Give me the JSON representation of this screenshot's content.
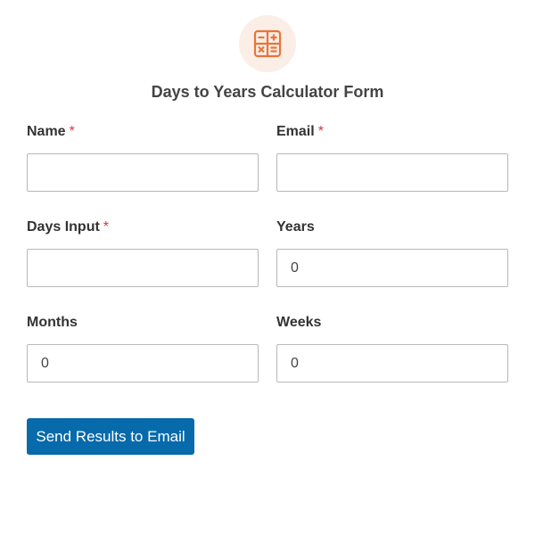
{
  "form": {
    "icon": "calculator-icon",
    "icon_color": "#e8743b",
    "icon_background": "#fbeee6",
    "title": "Days to Years Calculator Form",
    "required_mark": "*",
    "required_color": "#d63637",
    "fields": {
      "name": {
        "label": "Name",
        "value": "",
        "required": true
      },
      "email": {
        "label": "Email",
        "value": "",
        "required": true
      },
      "days_input": {
        "label": "Days Input",
        "value": "",
        "required": true
      },
      "years": {
        "label": "Years",
        "value": "0",
        "required": false
      },
      "months": {
        "label": "Months",
        "value": "0",
        "required": false
      },
      "weeks": {
        "label": "Weeks",
        "value": "0",
        "required": false
      }
    },
    "submit_label": "Send Results to Email",
    "submit_color": "#066aab"
  }
}
